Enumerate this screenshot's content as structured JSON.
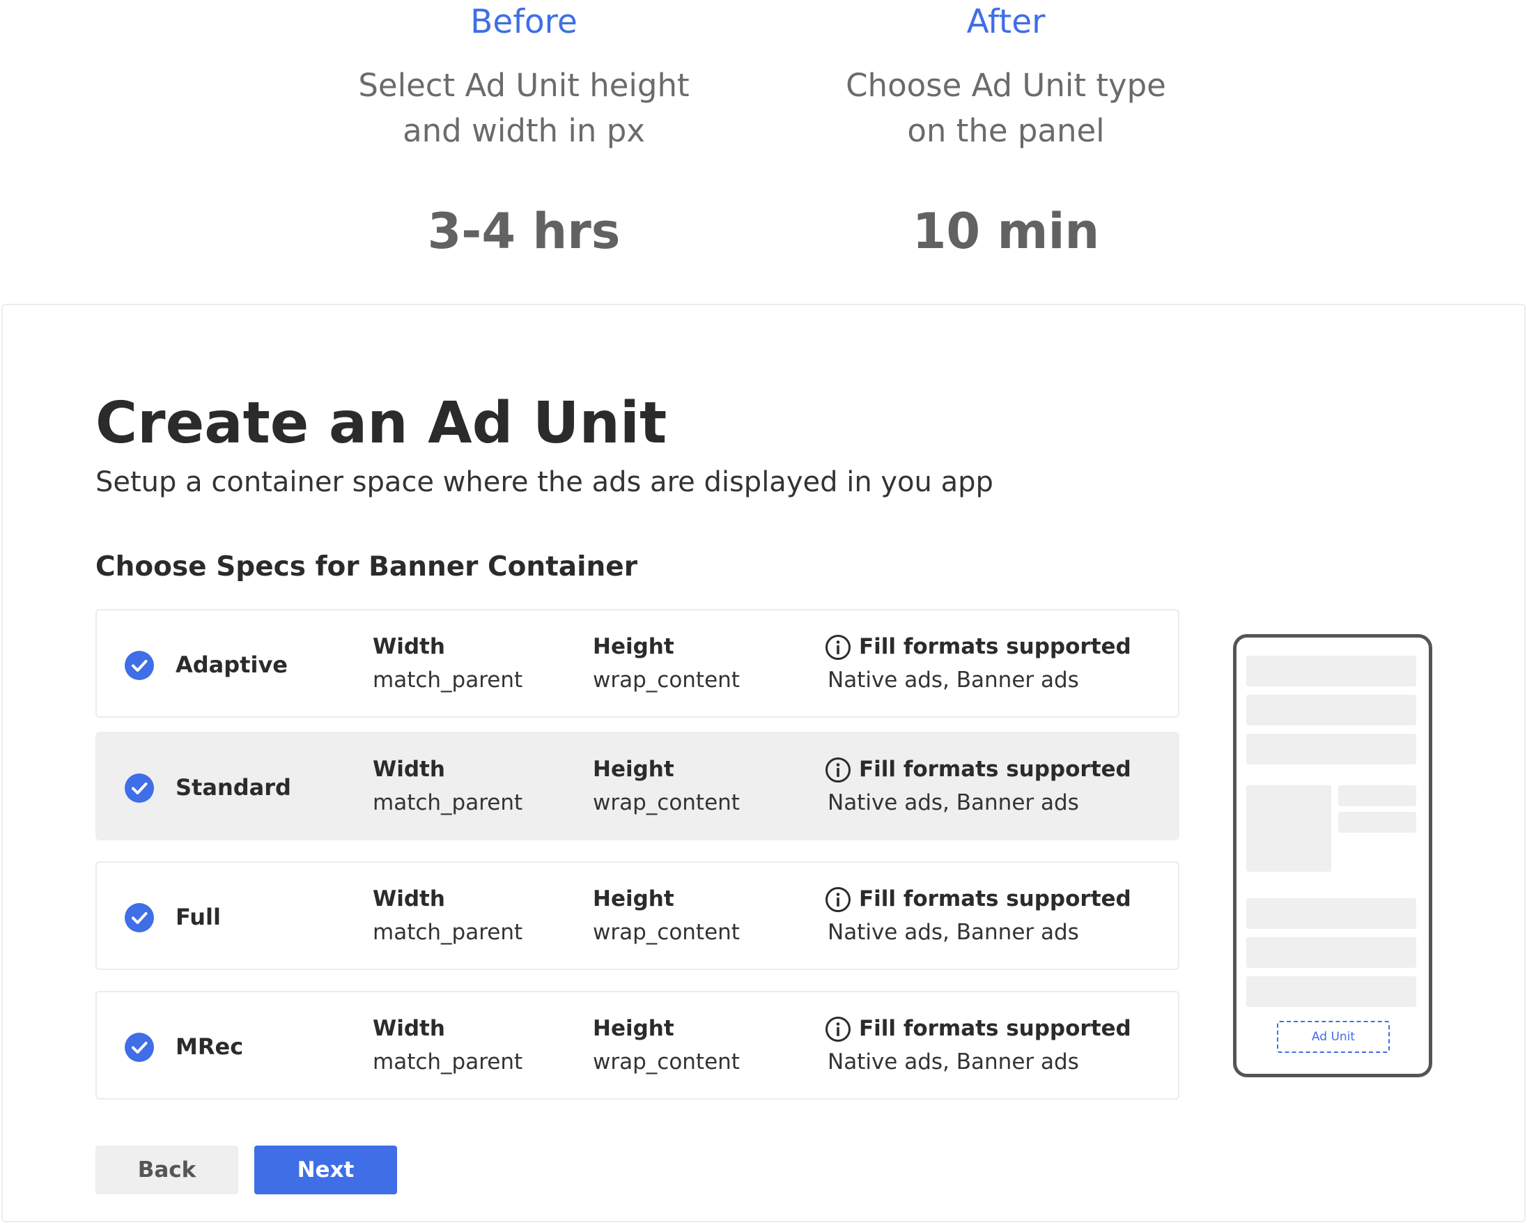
{
  "comparison": {
    "before": {
      "label": "Before",
      "line1": "Select Ad Unit height",
      "line2": "and width in px",
      "time": "3-4 hrs"
    },
    "after": {
      "label": "After",
      "line1": "Choose Ad Unit type",
      "line2": "on the panel",
      "time": "10 min"
    }
  },
  "card": {
    "title": "Create an Ad Unit",
    "subtitle": "Setup a container space where the ads are displayed in you app",
    "section_title": "Choose Specs for Banner Container"
  },
  "rows": [
    {
      "name": "Adaptive",
      "width_label": "Width",
      "width_value": "match_parent",
      "height_label": "Height",
      "height_value": "wrap_content",
      "fill_label": "Fill formats supported",
      "fill_value": "Native ads, Banner ads",
      "checked": true,
      "selected": false
    },
    {
      "name": "Standard",
      "width_label": "Width",
      "width_value": "match_parent",
      "height_label": "Height",
      "height_value": "wrap_content",
      "fill_label": "Fill formats supported",
      "fill_value": "Native ads, Banner ads",
      "checked": true,
      "selected": true
    },
    {
      "name": "Full",
      "width_label": "Width",
      "width_value": "match_parent",
      "height_label": "Height",
      "height_value": "wrap_content",
      "fill_label": "Fill formats supported",
      "fill_value": "Native ads, Banner ads",
      "checked": true,
      "selected": false
    },
    {
      "name": "MRec",
      "width_label": "Width",
      "width_value": "match_parent",
      "height_label": "Height",
      "height_value": "wrap_content",
      "fill_label": "Fill formats supported",
      "fill_value": "Native ads, Banner ads",
      "checked": true,
      "selected": false
    }
  ],
  "preview": {
    "ad_unit_label": "Ad Unit"
  },
  "buttons": {
    "back": "Back",
    "next": "Next"
  },
  "colors": {
    "accent": "#3f6ee6",
    "selected_row": "#efefef",
    "placeholder": "#efefef"
  },
  "icons": {
    "check": "check-circle-icon",
    "info": "info-icon"
  }
}
